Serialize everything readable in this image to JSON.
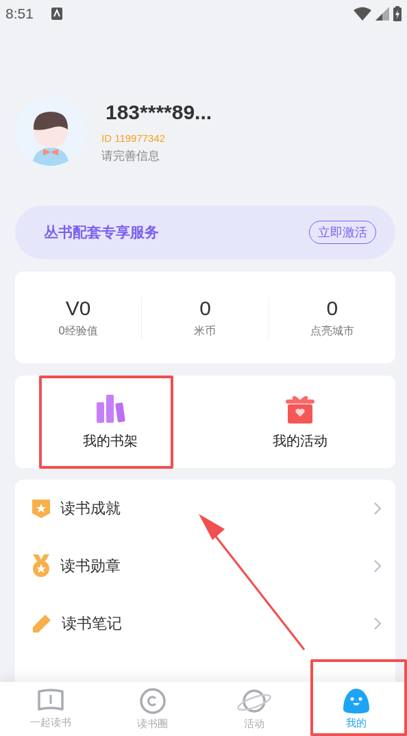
{
  "status_bar": {
    "time": "8:51"
  },
  "profile": {
    "name": "183****89...",
    "id": "ID 119977342",
    "hint": "请完善信息"
  },
  "banner": {
    "title": "丛书配套专享服务",
    "button": "立即激活"
  },
  "stats": [
    {
      "value": "V0",
      "label": "0经验值"
    },
    {
      "value": "0",
      "label": "米币"
    },
    {
      "value": "0",
      "label": "点亮城市"
    }
  ],
  "shortcuts": [
    {
      "kind": "bookshelf",
      "label": "我的书架"
    },
    {
      "kind": "gift",
      "label": "我的活动"
    }
  ],
  "menu": [
    {
      "kind": "achievement",
      "label": "读书成就"
    },
    {
      "kind": "medal",
      "label": "读书勋章"
    },
    {
      "kind": "note",
      "label": "读书笔记"
    }
  ],
  "tabs": [
    {
      "kind": "book",
      "label": "一起读书",
      "selected": false
    },
    {
      "kind": "circle",
      "label": "读书圈",
      "selected": false
    },
    {
      "kind": "planet",
      "label": "活动",
      "selected": false
    },
    {
      "kind": "mascot",
      "label": "我的",
      "selected": true
    }
  ],
  "annotations": [
    {
      "kind": "box"
    },
    {
      "kind": "box"
    },
    {
      "kind": "arrow"
    }
  ]
}
